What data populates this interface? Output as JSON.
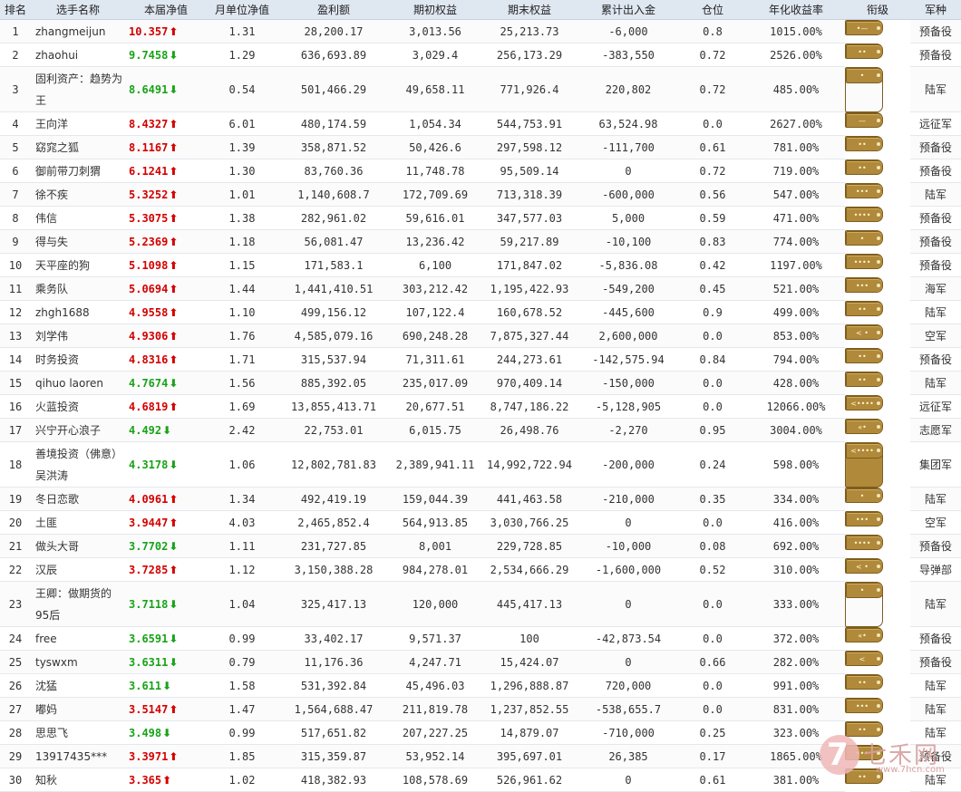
{
  "headers": [
    "排名",
    "选手名称",
    "本届净值",
    "月单位净值",
    "盈利额",
    "期初权益",
    "期末权益",
    "累计出入金",
    "仓位",
    "年化收益率",
    "衔级",
    "军种"
  ],
  "rows": [
    {
      "rank": "1",
      "name": "zhangmeijun",
      "nav": "10.357",
      "dir": "up",
      "monthly": "1.31",
      "profit": "28,200.17",
      "initial": "3,013.56",
      "final": "25,213.73",
      "flow": "-6,000",
      "position": "0.8",
      "annual": "1015.00%",
      "badge": "•—",
      "army": "预备役"
    },
    {
      "rank": "2",
      "name": "zhaohui",
      "nav": "9.7458",
      "dir": "down",
      "monthly": "1.29",
      "profit": "636,693.89",
      "initial": "3,029.4",
      "final": "256,173.29",
      "flow": "-383,550",
      "position": "0.72",
      "annual": "2526.00%",
      "badge": "••",
      "army": "预备役"
    },
    {
      "rank": "3",
      "name": "固利资产：趋势为王",
      "nav": "8.6491",
      "dir": "down",
      "monthly": "0.54",
      "profit": "501,466.29",
      "initial": "49,658.11",
      "final": "771,926.4",
      "flow": "220,802",
      "position": "0.72",
      "annual": "485.00%",
      "badge": "•",
      "army": "陆军",
      "tall": true
    },
    {
      "rank": "4",
      "name": "王向洋",
      "nav": "8.4327",
      "dir": "up",
      "monthly": "6.01",
      "profit": "480,174.59",
      "initial": "1,054.34",
      "final": "544,753.91",
      "flow": "63,524.98",
      "position": "0.0",
      "annual": "2627.00%",
      "badge": "—",
      "army": "远征军"
    },
    {
      "rank": "5",
      "name": "窈窕之狐",
      "nav": "8.1167",
      "dir": "up",
      "monthly": "1.39",
      "profit": "358,871.52",
      "initial": "50,426.6",
      "final": "297,598.12",
      "flow": "-111,700",
      "position": "0.61",
      "annual": "781.00%",
      "badge": "••",
      "army": "预备役"
    },
    {
      "rank": "6",
      "name": "御前带刀刺猬",
      "nav": "6.1241",
      "dir": "up",
      "monthly": "1.30",
      "profit": "83,760.36",
      "initial": "11,748.78",
      "final": "95,509.14",
      "flow": "0",
      "position": "0.72",
      "annual": "719.00%",
      "badge": "••",
      "army": "预备役"
    },
    {
      "rank": "7",
      "name": "徐不疾",
      "nav": "5.3252",
      "dir": "up",
      "monthly": "1.01",
      "profit": "1,140,608.7",
      "initial": "172,709.69",
      "final": "713,318.39",
      "flow": "-600,000",
      "position": "0.56",
      "annual": "547.00%",
      "badge": "•••",
      "army": "陆军"
    },
    {
      "rank": "8",
      "name": "伟信",
      "nav": "5.3075",
      "dir": "up",
      "monthly": "1.38",
      "profit": "282,961.02",
      "initial": "59,616.01",
      "final": "347,577.03",
      "flow": "5,000",
      "position": "0.59",
      "annual": "471.00%",
      "badge": "••••",
      "army": "预备役"
    },
    {
      "rank": "9",
      "name": "得与失",
      "nav": "5.2369",
      "dir": "up",
      "monthly": "1.18",
      "profit": "56,081.47",
      "initial": "13,236.42",
      "final": "59,217.89",
      "flow": "-10,100",
      "position": "0.83",
      "annual": "774.00%",
      "badge": "•",
      "army": "预备役"
    },
    {
      "rank": "10",
      "name": "天平座的狗",
      "nav": "5.1098",
      "dir": "up",
      "monthly": "1.15",
      "profit": "171,583.1",
      "initial": "6,100",
      "final": "171,847.02",
      "flow": "-5,836.08",
      "position": "0.42",
      "annual": "1197.00%",
      "badge": "••••",
      "army": "预备役"
    },
    {
      "rank": "11",
      "name": "乘务队",
      "nav": "5.0694",
      "dir": "up",
      "monthly": "1.44",
      "profit": "1,441,410.51",
      "initial": "303,212.42",
      "final": "1,195,422.93",
      "flow": "-549,200",
      "position": "0.45",
      "annual": "521.00%",
      "badge": "•••",
      "army": "海军"
    },
    {
      "rank": "12",
      "name": "zhgh1688",
      "nav": "4.9558",
      "dir": "up",
      "monthly": "1.10",
      "profit": "499,156.12",
      "initial": "107,122.4",
      "final": "160,678.52",
      "flow": "-445,600",
      "position": "0.9",
      "annual": "499.00%",
      "badge": "••",
      "army": "陆军"
    },
    {
      "rank": "13",
      "name": "刘学伟",
      "nav": "4.9306",
      "dir": "up",
      "monthly": "1.76",
      "profit": "4,585,079.16",
      "initial": "690,248.28",
      "final": "7,875,327.44",
      "flow": "2,600,000",
      "position": "0.0",
      "annual": "853.00%",
      "badge": "< •",
      "army": "空军"
    },
    {
      "rank": "14",
      "name": "时务投资",
      "nav": "4.8316",
      "dir": "up",
      "monthly": "1.71",
      "profit": "315,537.94",
      "initial": "71,311.61",
      "final": "244,273.61",
      "flow": "-142,575.94",
      "position": "0.84",
      "annual": "794.00%",
      "badge": "••",
      "army": "预备役"
    },
    {
      "rank": "15",
      "name": "qihuo laoren",
      "nav": "4.7674",
      "dir": "down",
      "monthly": "1.56",
      "profit": "885,392.05",
      "initial": "235,017.09",
      "final": "970,409.14",
      "flow": "-150,000",
      "position": "0.0",
      "annual": "428.00%",
      "badge": "••",
      "army": "陆军"
    },
    {
      "rank": "16",
      "name": "火蓝投资",
      "nav": "4.6819",
      "dir": "up",
      "monthly": "1.69",
      "profit": "13,855,413.71",
      "initial": "20,677.51",
      "final": "8,747,186.22",
      "flow": "-5,128,905",
      "position": "0.0",
      "annual": "12066.00%",
      "badge": "<••••",
      "army": "远征军"
    },
    {
      "rank": "17",
      "name": "兴宁开心浪子",
      "nav": "4.492",
      "dir": "down",
      "monthly": "2.42",
      "profit": "22,753.01",
      "initial": "6,015.75",
      "final": "26,498.76",
      "flow": "-2,270",
      "position": "0.95",
      "annual": "3004.00%",
      "badge": "«•",
      "army": "志愿军"
    },
    {
      "rank": "18",
      "name": "善境投资（佛意）吴洪涛",
      "nav": "4.3178",
      "dir": "down",
      "monthly": "1.06",
      "profit": "12,802,781.83",
      "initial": "2,389,941.11",
      "final": "14,992,722.94",
      "flow": "-200,000",
      "position": "0.24",
      "annual": "598.00%",
      "badge": "<••••",
      "army": "集团军",
      "tall": true
    },
    {
      "rank": "19",
      "name": "冬日恋歌",
      "nav": "4.0961",
      "dir": "up",
      "monthly": "1.34",
      "profit": "492,419.19",
      "initial": "159,044.39",
      "final": "441,463.58",
      "flow": "-210,000",
      "position": "0.35",
      "annual": "334.00%",
      "badge": "•",
      "army": "陆军"
    },
    {
      "rank": "20",
      "name": "土匪",
      "nav": "3.9447",
      "dir": "up",
      "monthly": "4.03",
      "profit": "2,465,852.4",
      "initial": "564,913.85",
      "final": "3,030,766.25",
      "flow": "0",
      "position": "0.0",
      "annual": "416.00%",
      "badge": "•••",
      "army": "空军"
    },
    {
      "rank": "21",
      "name": "做头大哥",
      "nav": "3.7702",
      "dir": "down",
      "monthly": "1.11",
      "profit": "231,727.85",
      "initial": "8,001",
      "final": "229,728.85",
      "flow": "-10,000",
      "position": "0.08",
      "annual": "692.00%",
      "badge": "••••",
      "army": "预备役"
    },
    {
      "rank": "22",
      "name": "汉辰",
      "nav": "3.7285",
      "dir": "up",
      "monthly": "1.12",
      "profit": "3,150,388.28",
      "initial": "984,278.01",
      "final": "2,534,666.29",
      "flow": "-1,600,000",
      "position": "0.52",
      "annual": "310.00%",
      "badge": "< •",
      "army": "导弹部"
    },
    {
      "rank": "23",
      "name": "王卿：做期货的95后",
      "nav": "3.7118",
      "dir": "down",
      "monthly": "1.04",
      "profit": "325,417.13",
      "initial": "120,000",
      "final": "445,417.13",
      "flow": "0",
      "position": "0.0",
      "annual": "333.00%",
      "badge": "•",
      "army": "陆军",
      "tall": true
    },
    {
      "rank": "24",
      "name": "free",
      "nav": "3.6591",
      "dir": "down",
      "monthly": "0.99",
      "profit": "33,402.17",
      "initial": "9,571.37",
      "final": "100",
      "flow": "-42,873.54",
      "position": "0.0",
      "annual": "372.00%",
      "badge": "«•",
      "army": "预备役"
    },
    {
      "rank": "25",
      "name": "tyswxm",
      "nav": "3.6311",
      "dir": "down",
      "monthly": "0.79",
      "profit": "11,176.36",
      "initial": "4,247.71",
      "final": "15,424.07",
      "flow": "0",
      "position": "0.66",
      "annual": "282.00%",
      "badge": "<",
      "army": "预备役"
    },
    {
      "rank": "26",
      "name": "沈猛",
      "nav": "3.611",
      "dir": "down",
      "monthly": "1.58",
      "profit": "531,392.84",
      "initial": "45,496.03",
      "final": "1,296,888.87",
      "flow": "720,000",
      "position": "0.0",
      "annual": "991.00%",
      "badge": "••",
      "army": "陆军"
    },
    {
      "rank": "27",
      "name": "嘟妈",
      "nav": "3.5147",
      "dir": "up",
      "monthly": "1.47",
      "profit": "1,564,688.47",
      "initial": "211,819.78",
      "final": "1,237,852.55",
      "flow": "-538,655.7",
      "position": "0.0",
      "annual": "831.00%",
      "badge": "•••",
      "army": "陆军"
    },
    {
      "rank": "28",
      "name": "思思飞",
      "nav": "3.498",
      "dir": "down",
      "monthly": "0.99",
      "profit": "517,651.82",
      "initial": "207,227.25",
      "final": "14,879.07",
      "flow": "-710,000",
      "position": "0.25",
      "annual": "323.00%",
      "badge": "••",
      "army": "陆军"
    },
    {
      "rank": "29",
      "name": "13917435***",
      "nav": "3.3971",
      "dir": "up",
      "monthly": "1.85",
      "profit": "315,359.87",
      "initial": "53,952.14",
      "final": "395,697.01",
      "flow": "26,385",
      "position": "0.17",
      "annual": "1865.00%",
      "badge": "•••",
      "army": "预备役"
    },
    {
      "rank": "30",
      "name": "知秋",
      "nav": "3.365",
      "dir": "up",
      "monthly": "1.02",
      "profit": "418,382.93",
      "initial": "108,578.69",
      "final": "526,961.62",
      "flow": "0",
      "position": "0.61",
      "annual": "381.00%",
      "badge": "••",
      "army": "陆军"
    }
  ],
  "watermark": {
    "text": "七禾网",
    "url": "www.7hcn.com",
    "glyph": "7"
  }
}
